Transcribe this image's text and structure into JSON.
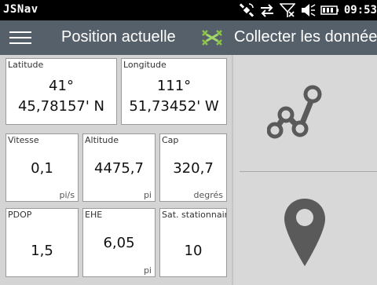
{
  "statusbar": {
    "app_name": "JSNav",
    "time": "09:53",
    "icons": [
      "satellite-icon",
      "sync-arrows-icon",
      "no-signal-icon",
      "volume-icon",
      "battery-icon"
    ]
  },
  "titlebar": {
    "menu_icon": "hamburger-icon",
    "left_title": "Position actuelle",
    "collect_icon": "collect-data-icon",
    "right_title": "Collecter les données",
    "accent_color": "#8bc34a"
  },
  "position": {
    "latitude": {
      "label": "Latitude",
      "deg": "41°",
      "min": "45,78157' N"
    },
    "longitude": {
      "label": "Longitude",
      "deg": "111°",
      "min": "51,73452' W"
    }
  },
  "metrics": [
    {
      "label": "Vitesse",
      "value": "0,1",
      "unit": "pi/s"
    },
    {
      "label": "Altitude",
      "value": "4475,7",
      "unit": "pi"
    },
    {
      "label": "Cap",
      "value": "320,7",
      "unit": "degrés"
    },
    {
      "label": "PDOP",
      "value": "1,5",
      "unit": ""
    },
    {
      "label": "EHE",
      "value": "6,05",
      "unit": "pi"
    },
    {
      "label": "Sat. stationnaires",
      "value": "10",
      "unit": ""
    }
  ],
  "actions": {
    "route_icon": "route-icon",
    "pin_icon": "map-pin-icon"
  }
}
